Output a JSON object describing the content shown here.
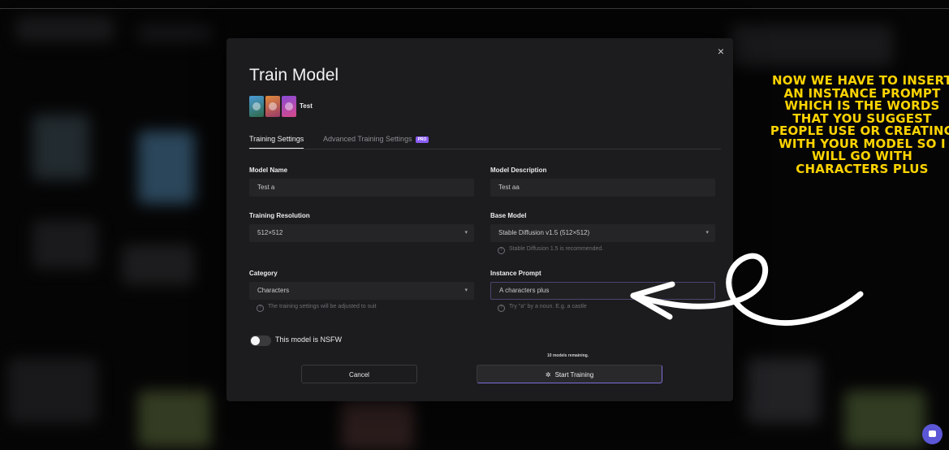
{
  "modal": {
    "title": "Train Model",
    "subject_name": "Test",
    "close_symbol": "×"
  },
  "tabs": {
    "training_settings": "Training Settings",
    "advanced": "Advanced Training Settings",
    "pro_badge": "PRO"
  },
  "form": {
    "model_name_label": "Model Name",
    "model_name_value": "Test a",
    "model_description_label": "Model Description",
    "model_description_value": "Test aa",
    "training_resolution_label": "Training Resolution",
    "training_resolution_value": "512×512",
    "base_model_label": "Base Model",
    "base_model_value": "Stable Diffusion v1.5 (512×512)",
    "base_model_hint": "Stable Diffusion 1.5 is recommended.",
    "category_label": "Category",
    "category_value": "Characters",
    "category_hint": "The training settings will be adjusted to suit",
    "instance_prompt_label": "Instance Prompt",
    "instance_prompt_value": "A characters plus",
    "instance_prompt_hint": "Try \"a\" by a noun. E.g. a castle"
  },
  "nsfw": {
    "label": "This model is NSFW",
    "enabled": false
  },
  "footer": {
    "remaining": "10 models remaining.",
    "cancel_label": "Cancel",
    "start_label": "Start Training",
    "start_icon": "✲"
  },
  "annotation": {
    "text": "NOW WE HAVE TO INSERT AN INSTANCE PROMPT WHICH IS THE WORDS THAT YOU SUGGEST PEOPLE USE OR CREATING WITH YOUR MODEL SO I WILL GO WITH CHARACTERS PLUS"
  },
  "colors": {
    "annotation": "#ffd400",
    "accent": "#7c6fd6",
    "pro_badge": "#8b5cf6",
    "chat_button": "#5b57d6"
  },
  "icons": {
    "close": "close-icon",
    "chevron": "chevron-down-icon",
    "info": "info-circle-icon",
    "train": "sparkle-icon",
    "chat": "chat-bubble-icon",
    "arrow": "hand-drawn-arrow"
  }
}
